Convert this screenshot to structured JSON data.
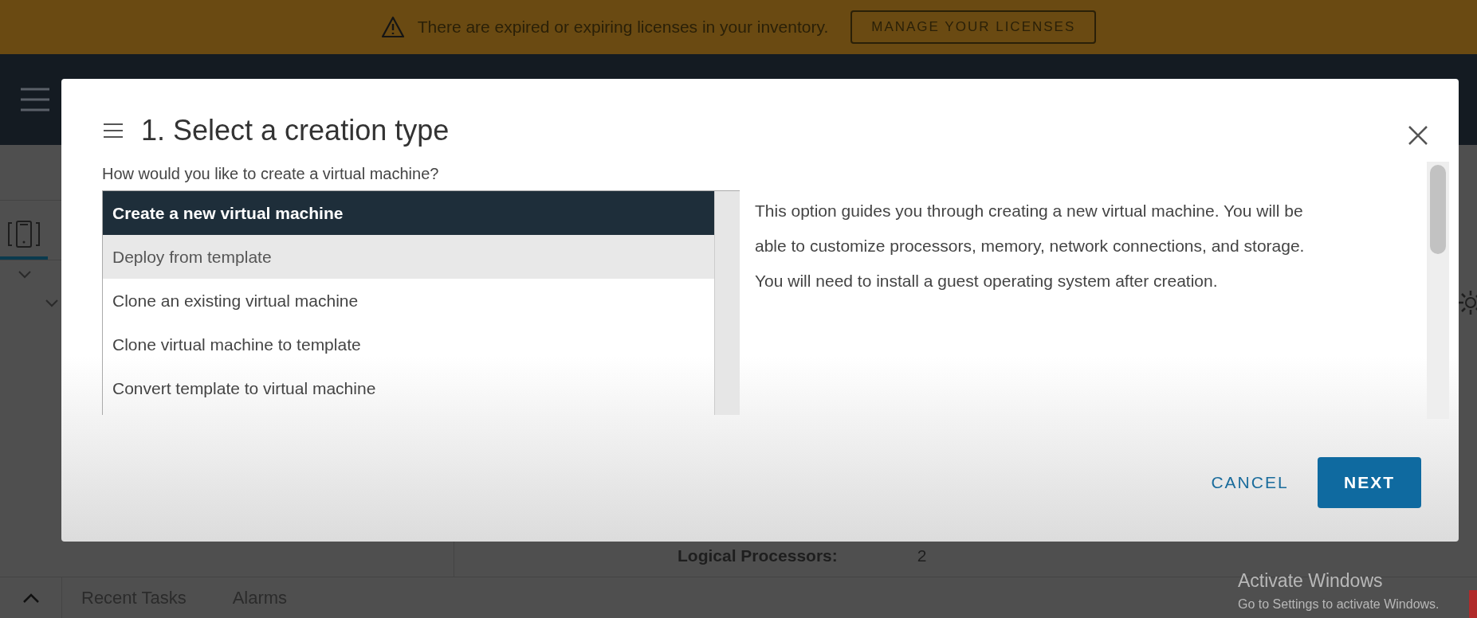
{
  "banner": {
    "message": "There are expired or expiring licenses in your inventory.",
    "button": "MANAGE YOUR LICENSES"
  },
  "background": {
    "bottom_tabs": [
      "Recent Tasks",
      "Alarms"
    ],
    "detail": {
      "label": "Logical Processors:",
      "value": "2"
    }
  },
  "dialog": {
    "title": "1. Select a creation type",
    "question": "How would you like to create a virtual machine?",
    "options": [
      {
        "label": "Create a new virtual machine",
        "selected": true,
        "hovered": false
      },
      {
        "label": "Deploy from template",
        "selected": false,
        "hovered": true
      },
      {
        "label": "Clone an existing virtual machine",
        "selected": false,
        "hovered": false
      },
      {
        "label": "Clone virtual machine to template",
        "selected": false,
        "hovered": false
      },
      {
        "label": "Convert template to virtual machine",
        "selected": false,
        "hovered": false
      }
    ],
    "description": "This option guides you through creating a new virtual machine. You will be able to customize processors, memory, network connections, and storage. You will need to install a guest operating system after creation.",
    "buttons": [
      {
        "label": "CANCEL",
        "kind": "secondary"
      },
      {
        "label": "NEXT",
        "kind": "primary"
      }
    ]
  },
  "os_notice": {
    "title": "Activate Windows",
    "text": "Go to Settings to activate Windows."
  }
}
